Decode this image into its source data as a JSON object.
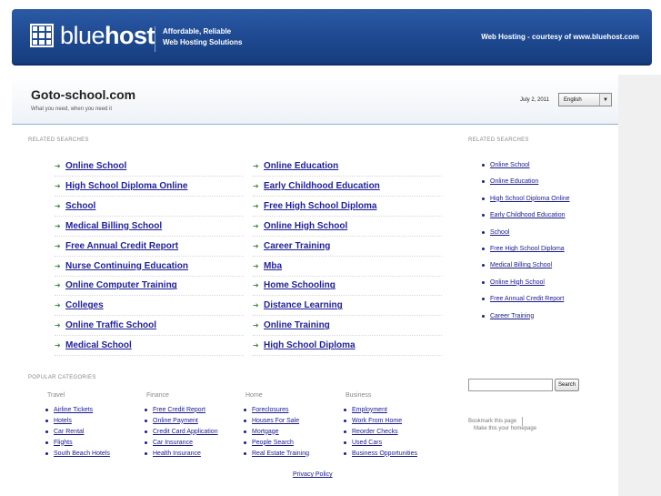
{
  "banner": {
    "logo_light": "blue",
    "logo_bold": "host",
    "tagline_1": "Affordable, Reliable",
    "tagline_2": "Web Hosting Solutions",
    "courtesy": "Web Hosting - courtesy of www.bluehost.com"
  },
  "site": {
    "title": "Goto-school.com",
    "subtitle": "What you need, when you need it",
    "date": "July 2, 2011",
    "language": "English"
  },
  "related": {
    "label_main": "RELATED SEARCHES",
    "label_side": "RELATED SEARCHES",
    "left": [
      "Online School",
      "High School Diploma Online",
      "School",
      "Medical Billing School",
      "Free Annual Credit Report",
      "Nurse Continuing Education",
      "Online Computer Training",
      "Colleges",
      "Online Traffic School",
      "Medical School"
    ],
    "right": [
      "Online Education",
      "Early Childhood Education",
      "Free High School Diploma",
      "Online High School",
      "Career Training",
      "Mba",
      "Home Schooling",
      "Distance Learning",
      "Online Training",
      "High School Diploma"
    ],
    "side": [
      "Online School",
      "Online Education",
      "High School Diploma Online",
      "Early Childhood Education",
      "School",
      "Free High School Diploma",
      "Medical Billing School",
      "Online High School",
      "Free Annual Credit Report",
      "Career Training"
    ]
  },
  "categories": {
    "label": "POPULAR CATEGORIES",
    "columns": [
      {
        "title": "Travel",
        "items": [
          "Airline Tickets",
          "Hotels",
          "Car Rental",
          "Flights",
          "South Beach Hotels"
        ]
      },
      {
        "title": "Finance",
        "items": [
          "Free Credit Report",
          "Online Payment",
          "Credit Card Application",
          "Car Insurance",
          "Health Insurance"
        ]
      },
      {
        "title": "Home",
        "items": [
          "Foreclosures",
          "Houses For Sale",
          "Mortgage",
          "People Search",
          "Real Estate Training"
        ]
      },
      {
        "title": "Business",
        "items": [
          "Employment",
          "Work From Home",
          "Reorder Checks",
          "Used Cars",
          "Business Opportunities"
        ]
      }
    ]
  },
  "search": {
    "button": "Search",
    "bookmark": "Bookmark this page",
    "homepage": "Make this your homepage"
  },
  "footer": {
    "privacy": "Privacy Policy"
  },
  "colors": {
    "banner": "#1f4a92",
    "link": "#1f1f9a",
    "arrow": "#3d8a3d"
  }
}
